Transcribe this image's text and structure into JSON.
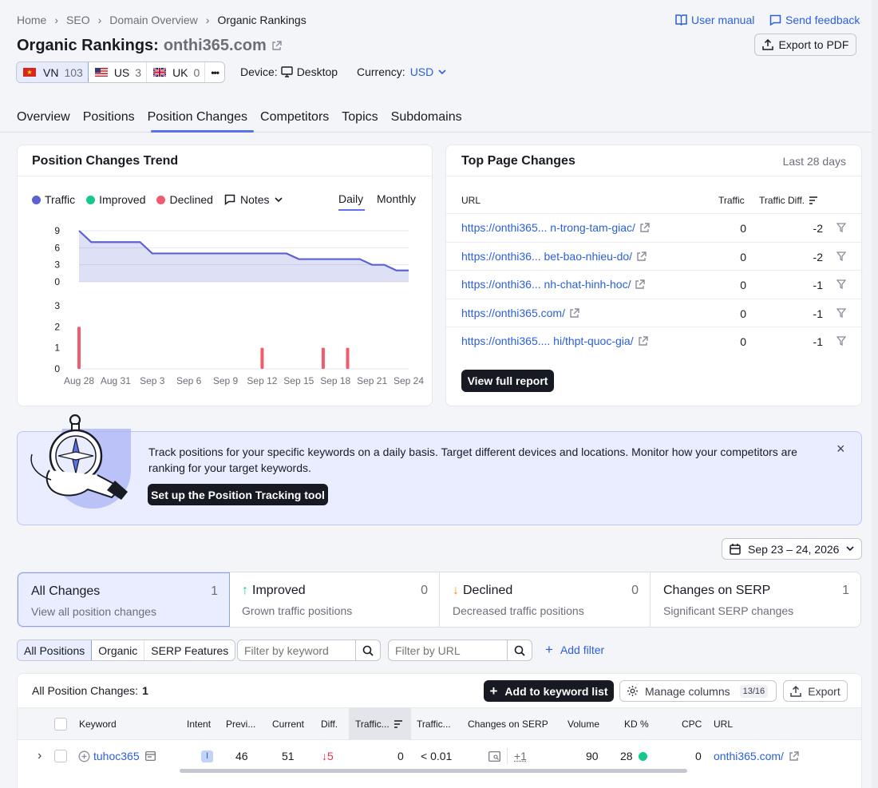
{
  "breadcrumb": [
    "Home",
    "SEO",
    "Domain Overview",
    "Organic Rankings"
  ],
  "header": {
    "user_manual": "User manual",
    "send_feedback": "Send feedback",
    "title_prefix": "Organic Rankings:",
    "domain": "onthi365.com",
    "export_pdf": "Export to PDF"
  },
  "databases": [
    {
      "code": "VN",
      "count": "103"
    },
    {
      "code": "US",
      "count": "3"
    },
    {
      "code": "UK",
      "count": "0"
    }
  ],
  "more_label": "•••",
  "device": {
    "label": "Device:",
    "value": "Desktop"
  },
  "currency": {
    "label": "Currency:",
    "value": "USD"
  },
  "tabs": [
    "Overview",
    "Positions",
    "Position Changes",
    "Competitors",
    "Topics",
    "Subdomains"
  ],
  "trend": {
    "title": "Position Changes Trend",
    "legend": {
      "traffic": "Traffic",
      "improved": "Improved",
      "declined": "Declined",
      "notes": "Notes"
    },
    "daily": "Daily",
    "monthly": "Monthly",
    "colors": {
      "traffic": "#5c62d1",
      "improved": "#17c88e",
      "declined": "#f25b6d"
    }
  },
  "chart_data": [
    {
      "type": "area",
      "series": [
        {
          "name": "Traffic",
          "values": [
            9,
            7,
            7,
            7,
            7,
            7,
            5,
            5,
            5,
            5,
            5,
            5,
            5,
            5,
            5,
            5,
            5,
            5,
            4,
            4,
            4,
            4,
            4,
            4,
            3,
            3,
            2,
            2,
            2,
            2,
            2,
            2
          ]
        }
      ],
      "x": [
        "Aug 28",
        "Aug 29",
        "Aug 30",
        "Aug 31",
        "Sep 1",
        "Sep 2",
        "Sep 3",
        "Sep 4",
        "Sep 5",
        "Sep 6",
        "Sep 7",
        "Sep 8",
        "Sep 9",
        "Sep 10",
        "Sep 11",
        "Sep 12",
        "Sep 13",
        "Sep 14",
        "Sep 15",
        "Sep 16",
        "Sep 17",
        "Sep 18",
        "Sep 19",
        "Sep 20",
        "Sep 21",
        "Sep 22",
        "Sep 23",
        "Sep 24"
      ],
      "yticks": [
        "9",
        "6",
        "3",
        "0"
      ],
      "ylim": [
        0,
        9
      ]
    },
    {
      "type": "bar",
      "series": [
        {
          "name": "Declined",
          "values": [
            {
              "x": "Aug 28",
              "y": 2
            },
            {
              "x": "Sep 12",
              "y": 1
            },
            {
              "x": "Sep 17",
              "y": 1
            },
            {
              "x": "Sep 19",
              "y": 1
            }
          ]
        }
      ],
      "xticks": [
        "Aug 28",
        "Aug 31",
        "Sep 3",
        "Sep 6",
        "Sep 9",
        "Sep 12",
        "Sep 15",
        "Sep 18",
        "Sep 21",
        "Sep 24"
      ],
      "yticks": [
        "3",
        "2",
        "1",
        "0"
      ],
      "ylim": [
        0,
        3
      ]
    }
  ],
  "top_pages": {
    "title": "Top Page Changes",
    "period": "Last 28 days",
    "headers": {
      "url": "URL",
      "traffic": "Traffic",
      "diff": "Traffic Diff."
    },
    "rows": [
      {
        "url": "https://onthi365... n-trong-tam-giac/",
        "traffic": "0",
        "diff": "-2"
      },
      {
        "url": "https://onthi36... bet-bao-nhieu-do/",
        "traffic": "0",
        "diff": "-2"
      },
      {
        "url": "https://onthi36... nh-chat-hinh-hoc/",
        "traffic": "0",
        "diff": "-1"
      },
      {
        "url": "https://onthi365.com/",
        "traffic": "0",
        "diff": "-1"
      },
      {
        "url": "https://onthi365.... hi/thpt-quoc-gia/",
        "traffic": "0",
        "diff": "-1"
      }
    ],
    "view_full": "View full report"
  },
  "banner": {
    "text": "Track positions for your specific keywords on a daily basis. Target different devices and locations. Monitor how your competitors are ranking for your target keywords.",
    "button": "Set up the Position Tracking tool",
    "close": "×"
  },
  "date_range": "Sep 23 – 24, 2026",
  "summary_cards": [
    {
      "title": "All Changes",
      "count": "1",
      "sub": "View all position changes"
    },
    {
      "title": "Improved",
      "count": "0",
      "sub": "Grown traffic positions"
    },
    {
      "title": "Declined",
      "count": "0",
      "sub": "Decreased traffic positions"
    },
    {
      "title": "Changes on SERP",
      "count": "1",
      "sub": "Significant SERP changes"
    }
  ],
  "filters": {
    "segments": [
      "All Positions",
      "Organic",
      "SERP Features"
    ],
    "keyword_placeholder": "Filter by keyword",
    "url_placeholder": "Filter by URL",
    "add_filter": "Add filter"
  },
  "table": {
    "title_label": "All Position Changes:",
    "title_count": "1",
    "add_keyword_list": "Add to keyword list",
    "manage_columns": "Manage columns",
    "columns_count": "13/16",
    "export": "Export",
    "headers": [
      "Keyword",
      "Intent",
      "Previ...",
      "Current",
      "Diff.",
      "Traffic...",
      "Traffic...",
      "Changes on SERP",
      "Volume",
      "KD %",
      "CPC",
      "URL"
    ],
    "rows": [
      {
        "keyword": "tuhoc365",
        "intent": "I",
        "previous": "46",
        "current": "51",
        "diff": "5",
        "traffic": "0",
        "traffic_pct": "< 0.01",
        "serp": "+1",
        "volume": "90",
        "kd": "28",
        "cpc": "0",
        "url": "onthi365.com/"
      }
    ]
  }
}
